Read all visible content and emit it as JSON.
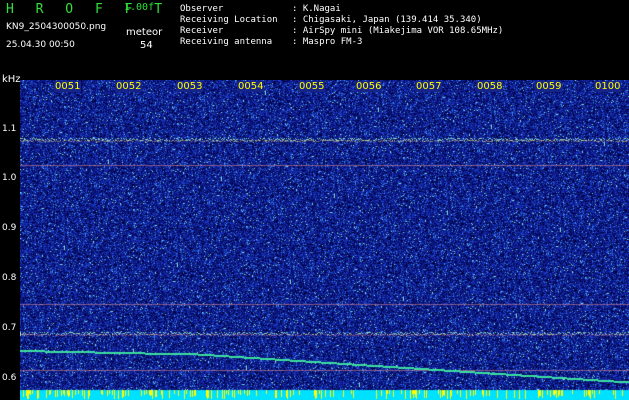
{
  "header": {
    "title": "H R O F F T",
    "version": "1.00f",
    "filename": "KN9_2504300050.png",
    "meteor_label": "meteor",
    "datetime": "25.04.30 00:50",
    "meteor_count": "54"
  },
  "info": [
    {
      "key": "Observer",
      "value": ": K.Nagai"
    },
    {
      "key": "Receiving Location",
      "value": ": Chigasaki, Japan (139.414 35.340)"
    },
    {
      "key": "Receiver",
      "value": ": AirSpy mini (Miakejima VOR 108.65MHz)"
    },
    {
      "key": "Receiving antenna",
      "value": ": Maspro FM-3"
    }
  ],
  "axis": {
    "unit": "kHz",
    "y_ticks": [
      "1.1",
      "1.0",
      "0.9",
      "0.8",
      "0.7",
      "0.6"
    ],
    "x_ticks": [
      "0051",
      "0052",
      "0053",
      "0054",
      "0055",
      "0056",
      "0057",
      "0058",
      "0059",
      "0100"
    ]
  },
  "colors": {
    "background": "#000000",
    "spectrum_noise": "#1a2a9a",
    "carrier": "#3ce0a0",
    "bottom_bar": "#00e0ff",
    "meteor_ticks": "#ffff00",
    "header_green": "#2fe03a",
    "tick_yellow": "#ffff00"
  }
}
